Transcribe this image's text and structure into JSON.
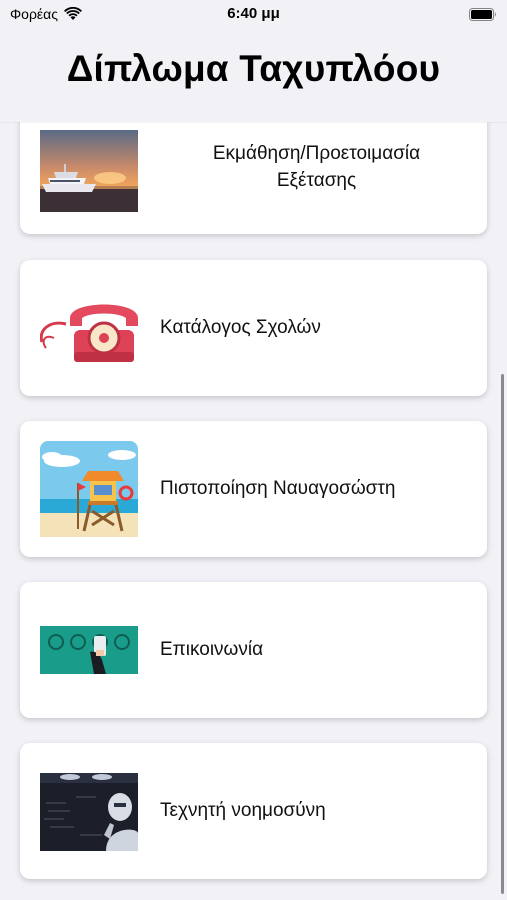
{
  "status_bar": {
    "carrier": "Φορέας",
    "time": "6:40 μμ"
  },
  "header": {
    "title": "Δίπλωμα Ταχυπλόου"
  },
  "menu": {
    "items": [
      {
        "label_line1": "Εκμάθηση/Προετοιμασία",
        "label_line2": "Εξέτασης",
        "icon": "yacht-sunset-image"
      },
      {
        "label": "Κατάλογος Σχολών",
        "icon": "red-telephone-image"
      },
      {
        "label": "Πιστοποίηση Ναυαγοσώστη",
        "icon": "lifeguard-tower-image"
      },
      {
        "label": "Επικοινωνία",
        "icon": "contact-icons-image"
      },
      {
        "label": "Τεχνητή νοημοσύνη",
        "icon": "robot-ai-image"
      }
    ]
  },
  "colors": {
    "background": "#f1f1f6",
    "card": "#ffffff",
    "contact_teal": "#1a9c8a"
  }
}
